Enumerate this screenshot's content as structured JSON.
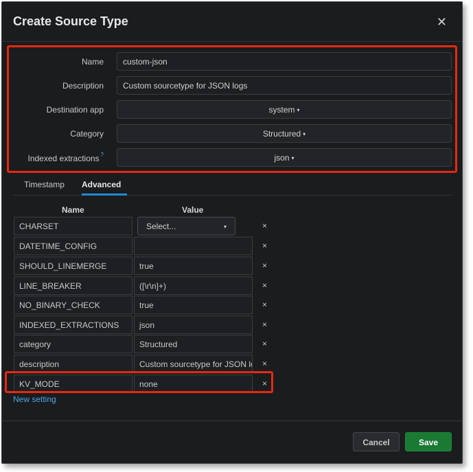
{
  "modal": {
    "title": "Create Source Type",
    "close_glyph": "✕"
  },
  "form": {
    "name": {
      "label": "Name",
      "value": "custom-json"
    },
    "description": {
      "label": "Description",
      "value": "Custom sourcetype for JSON logs"
    },
    "destination_app": {
      "label": "Destination app",
      "value": "system"
    },
    "category": {
      "label": "Category",
      "value": "Structured"
    },
    "indexed_extractions": {
      "label": "Indexed extractions",
      "help_glyph": "?",
      "value": "json"
    }
  },
  "tabs": [
    {
      "label": "Timestamp",
      "active": false
    },
    {
      "label": "Advanced",
      "active": true
    }
  ],
  "settings_table": {
    "headers": {
      "name": "Name",
      "value": "Value"
    },
    "rows": [
      {
        "name": "CHARSET",
        "value": "Select...",
        "is_select": true
      },
      {
        "name": "DATETIME_CONFIG",
        "value": ""
      },
      {
        "name": "SHOULD_LINEMERGE",
        "value": "true"
      },
      {
        "name": "LINE_BREAKER",
        "value": "([\\r\\n]+)"
      },
      {
        "name": "NO_BINARY_CHECK",
        "value": "true"
      },
      {
        "name": "INDEXED_EXTRACTIONS",
        "value": "json"
      },
      {
        "name": "category",
        "value": "Structured"
      },
      {
        "name": "description",
        "value": "Custom sourcetype for JSON logs"
      },
      {
        "name": "KV_MODE",
        "value": "none"
      }
    ],
    "delete_glyph": "×",
    "new_setting_label": "New setting"
  },
  "footer": {
    "cancel_label": "Cancel",
    "save_label": "Save"
  },
  "colors": {
    "highlight": "#e42a13",
    "save_button": "#1a7a33",
    "link": "#4aa5e8",
    "tab_underline": "#1f8ad6"
  },
  "icons": {
    "caret": "▾"
  }
}
